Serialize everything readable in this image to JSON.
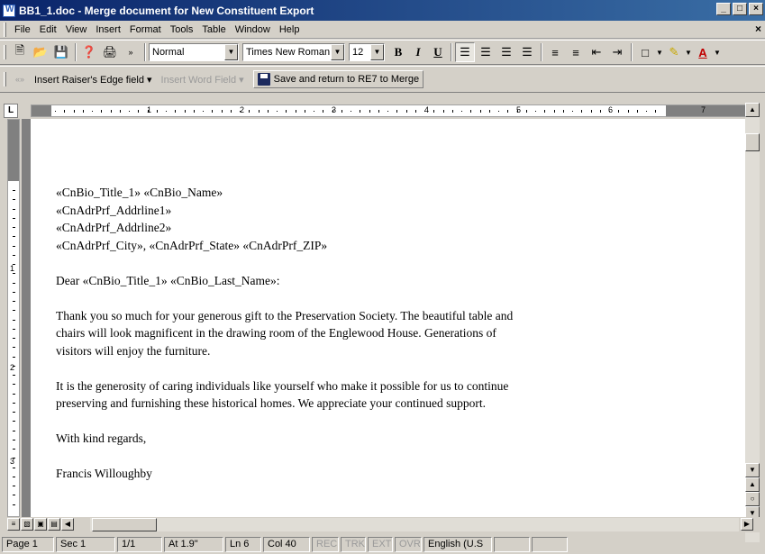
{
  "window": {
    "title": "BB1_1.doc - Merge document for New Constituent Export",
    "buttons": [
      "_",
      "□",
      "×"
    ]
  },
  "menu": {
    "items": [
      "File",
      "Edit",
      "View",
      "Insert",
      "Format",
      "Tools",
      "Table",
      "Window",
      "Help"
    ],
    "close": "×"
  },
  "toolbar": {
    "style": "Normal",
    "font": "Times New Roman",
    "size": "12",
    "bold": "B",
    "italic": "I",
    "underline": "U"
  },
  "merge_toolbar": {
    "insert_field": "Insert Raiser's Edge field ▾",
    "insert_word_field": "Insert Word Field ▾",
    "save_return": "Save and return to RE7 to Merge"
  },
  "ruler": {
    "numbers": [
      "1",
      "2",
      "3",
      "4",
      "5",
      "6",
      "7"
    ],
    "vnumbers": [
      "1",
      "2",
      "3"
    ],
    "corner": "L"
  },
  "document": {
    "lines": [
      "«CnBio_Title_1» «CnBio_Name»",
      "«CnAdrPrf_Addrline1»",
      "«CnAdrPrf_Addrline2»",
      "«CnAdrPrf_City», «CnAdrPrf_State» «CnAdrPrf_ZIP»",
      "",
      "Dear «CnBio_Title_1» «CnBio_Last_Name»:",
      "",
      "Thank you so much for your generous gift to the Preservation Society.  The beautiful table and",
      "chairs will look magnificent in the drawing room of the Englewood House.  Generations of",
      "visitors will enjoy the furniture.",
      "",
      "It is the generosity of caring individuals like yourself who make it possible for us to continue",
      "preserving and furnishing these historical homes.  We appreciate your continued support.",
      "",
      "With kind regards,",
      "",
      "Francis Willoughby"
    ]
  },
  "status": {
    "page": "Page  1",
    "sec": "Sec  1",
    "pages": "1/1",
    "at": "At  1.9\"",
    "ln": "Ln  6",
    "col": "Col  40",
    "rec": "REC",
    "trk": "TRK",
    "ext": "EXT",
    "ovr": "OVR",
    "lang": "English (U.S"
  }
}
